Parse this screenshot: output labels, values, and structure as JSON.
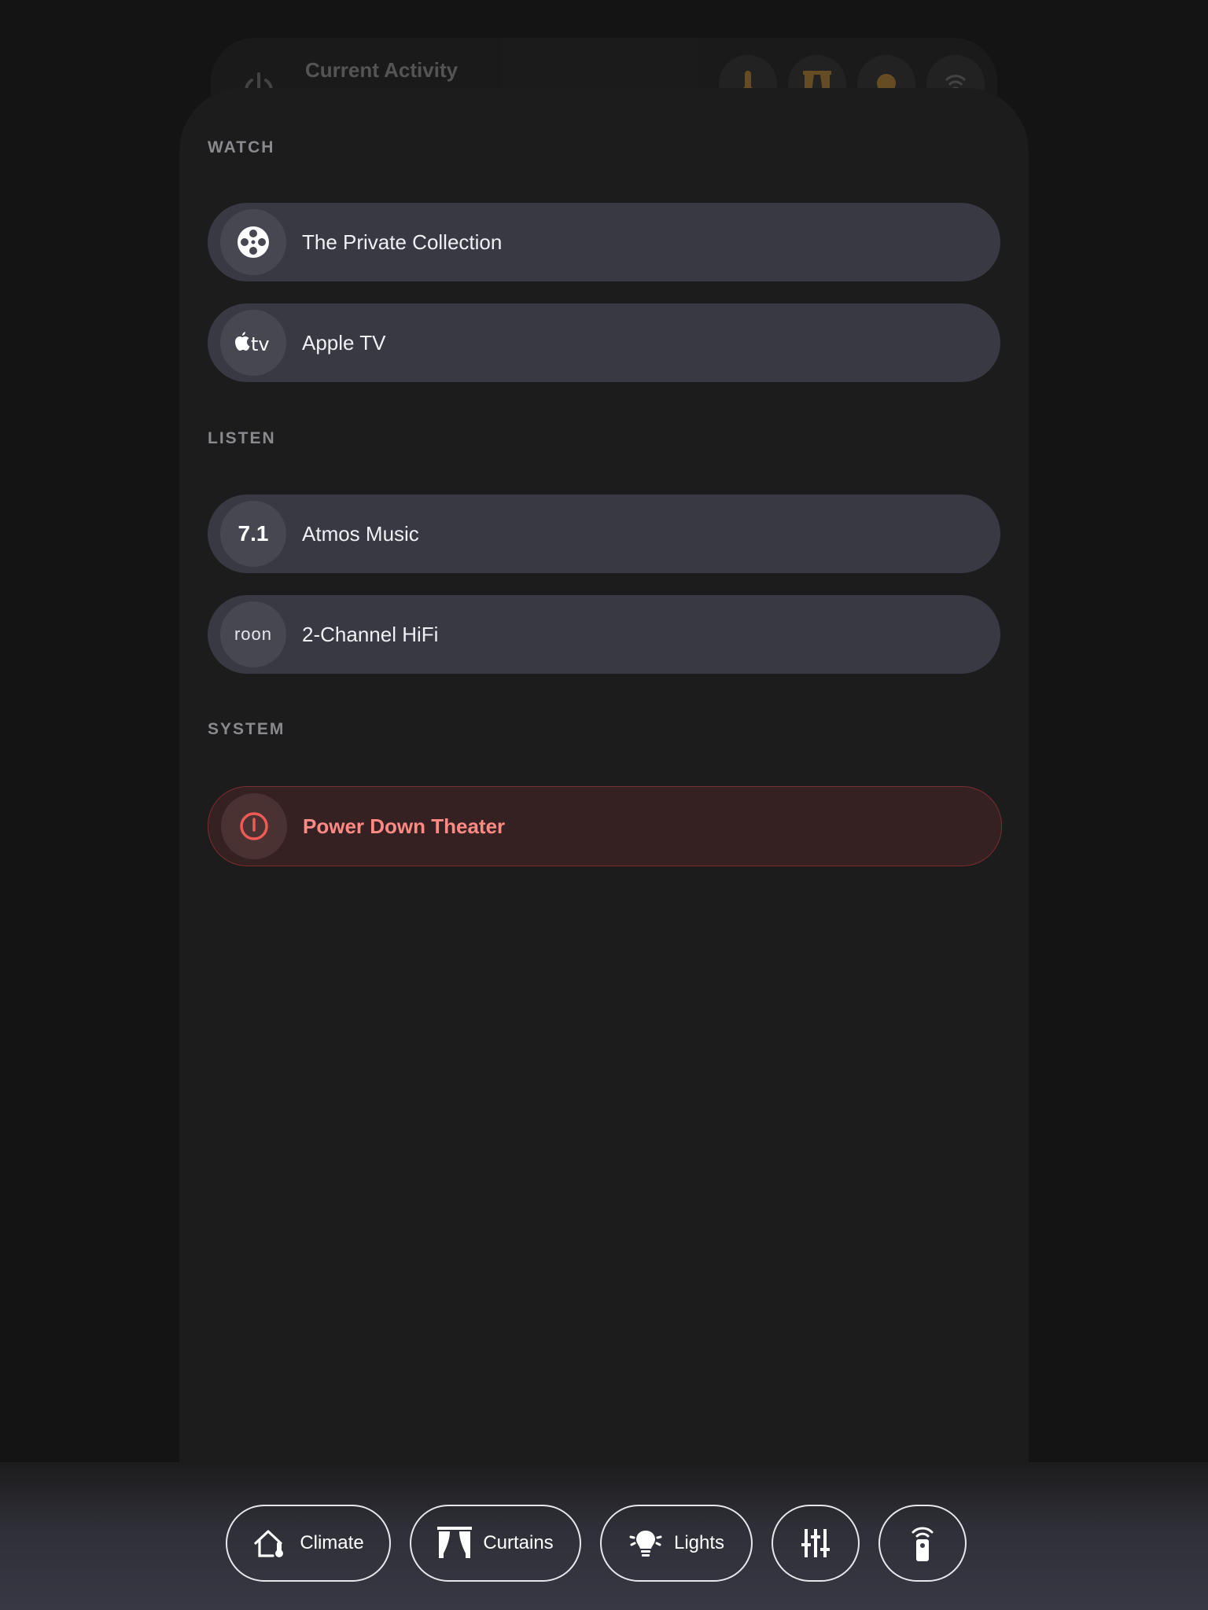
{
  "header": {
    "title": "Current Activity"
  },
  "sections": {
    "watch": {
      "label": "WATCH",
      "items": [
        {
          "label": "The Private Collection",
          "icon": "film-reel-icon"
        },
        {
          "label": "Apple TV",
          "icon": "apple-tv-icon"
        }
      ]
    },
    "listen": {
      "label": "LISTEN",
      "items": [
        {
          "label": "Atmos Music",
          "icon": "surround-7-1-icon",
          "badge": "7.1"
        },
        {
          "label": "2-Channel HiFi",
          "icon": "roon-icon",
          "badge": "roon"
        }
      ]
    },
    "system": {
      "label": "SYSTEM",
      "items": [
        {
          "label": "Power Down Theater",
          "icon": "power-icon"
        }
      ]
    }
  },
  "dock": {
    "climate": "Climate",
    "curtains": "Curtains",
    "lights": "Lights",
    "equalizer_icon": "sliders-icon",
    "remote_icon": "remote-icon"
  },
  "colors": {
    "background": "#141414",
    "sheet": "#1c1c1d",
    "row": "#393944",
    "danger_text": "#ff8a85",
    "danger_icon": "#f05a56",
    "accent_amber": "#a97a2e"
  }
}
